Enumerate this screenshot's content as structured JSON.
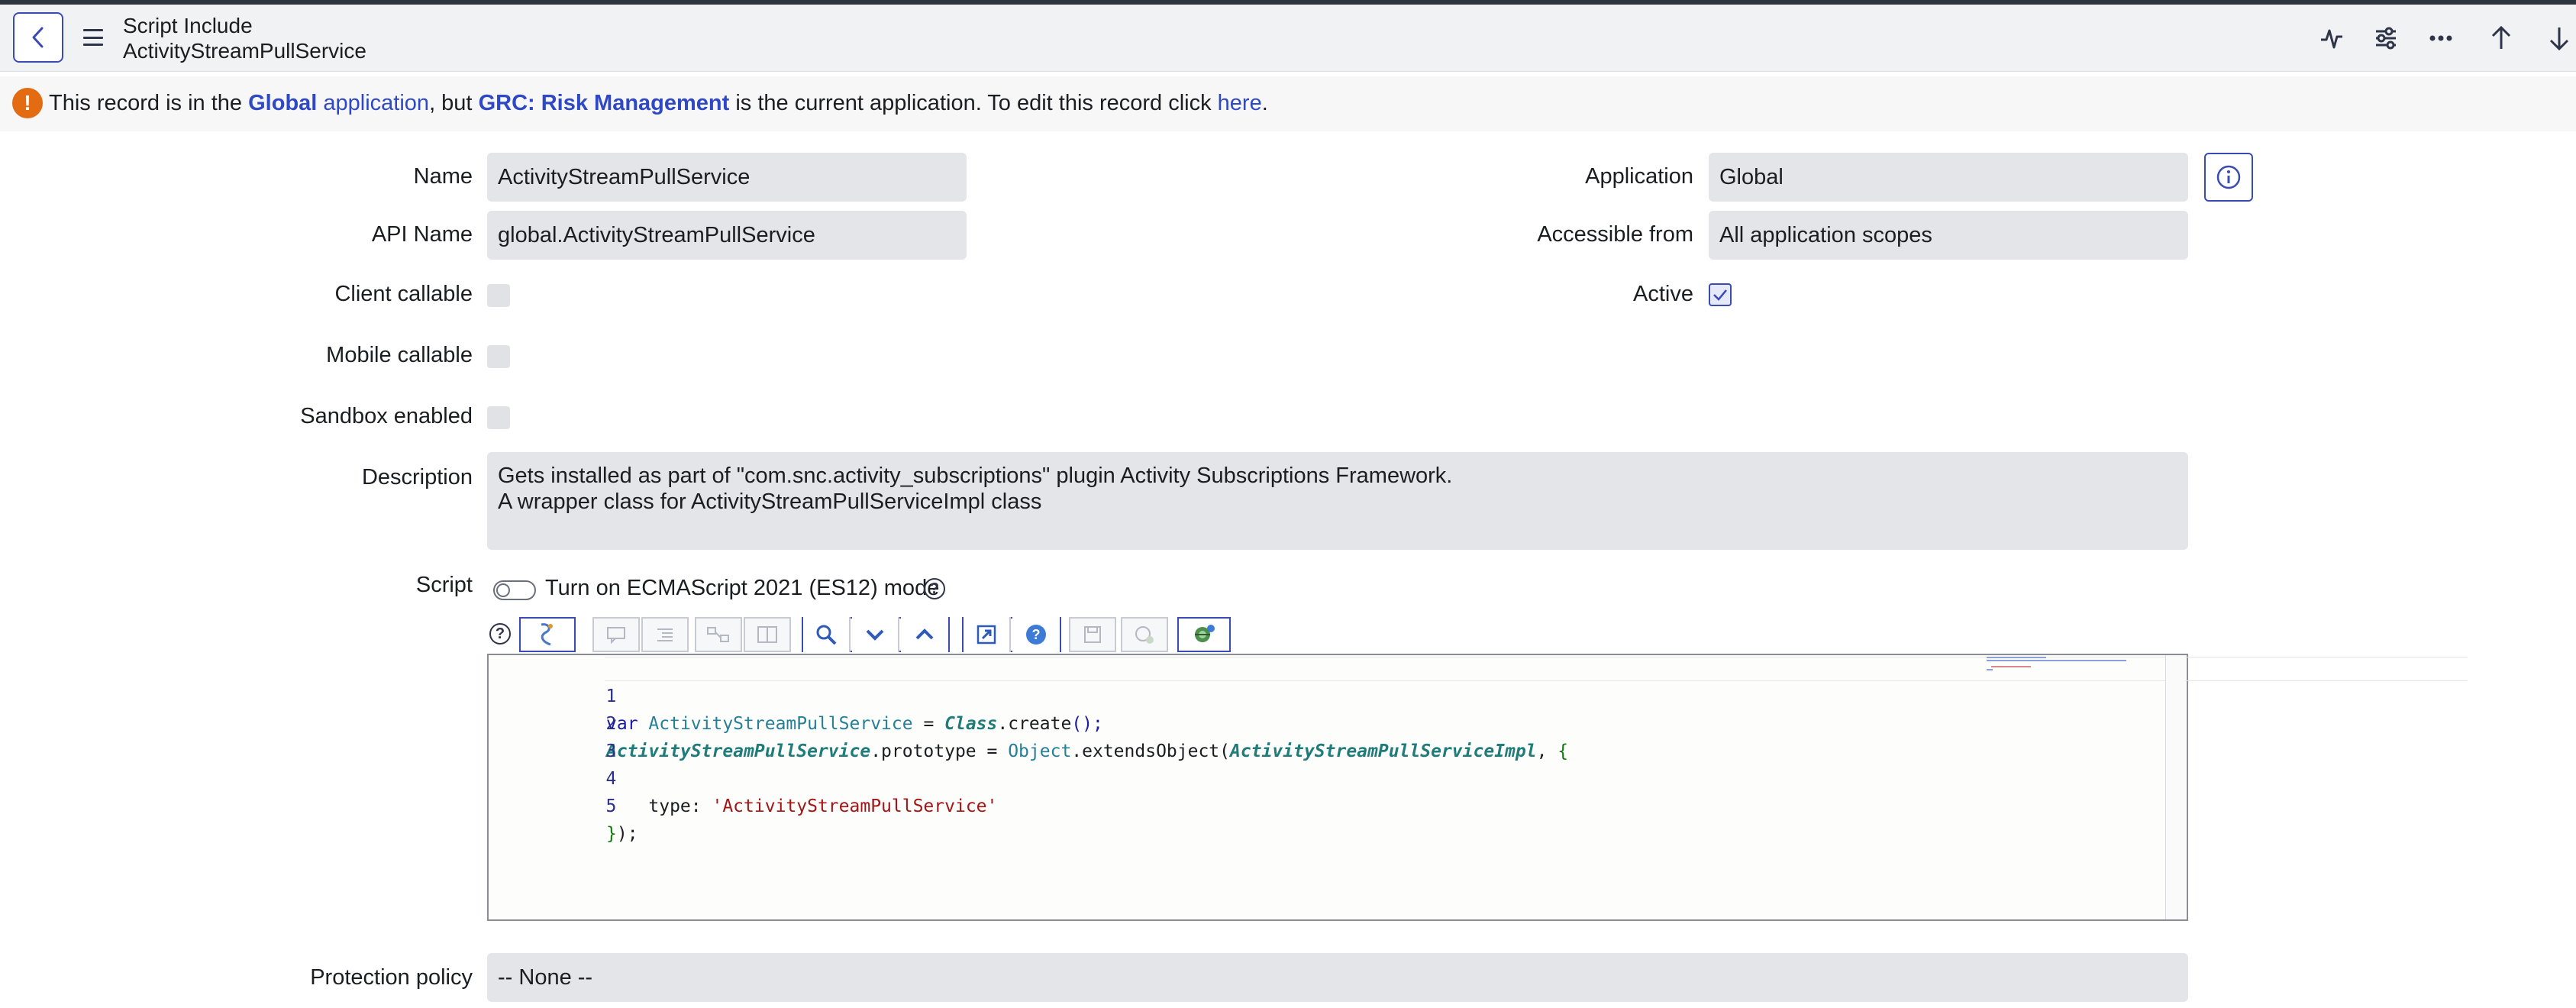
{
  "header": {
    "record_type": "Script Include",
    "record_name": "ActivityStreamPullService"
  },
  "banner": {
    "text_1": "This record is in the ",
    "link_app": "Global",
    "link_app_suffix": " application",
    "text_2": ", but ",
    "link_current": "GRC: Risk Management",
    "text_3": " is the current application. To edit this record click ",
    "link_here": "here",
    "text_4": "."
  },
  "form": {
    "name_label": "Name",
    "name_value": "ActivityStreamPullService",
    "api_name_label": "API Name",
    "api_name_value": "global.ActivityStreamPullService",
    "client_callable_label": "Client callable",
    "client_callable_checked": false,
    "mobile_callable_label": "Mobile callable",
    "mobile_callable_checked": false,
    "sandbox_enabled_label": "Sandbox enabled",
    "sandbox_enabled_checked": false,
    "application_label": "Application",
    "application_value": "Global",
    "accessible_from_label": "Accessible from",
    "accessible_from_value": "All application scopes",
    "active_label": "Active",
    "active_checked": true,
    "description_label": "Description",
    "description_line_1": "Gets installed as part of \"com.snc.activity_subscriptions\" plugin Activity Subscriptions Framework.",
    "description_line_2": "A wrapper class for ActivityStreamPullServiceImpl class",
    "script_label": "Script",
    "ecmascript_toggle_label": "Turn on ECMAScript 2021 (ES12) mode",
    "ecmascript_toggle_on": false,
    "protection_policy_label": "Protection policy",
    "protection_policy_value": "-- None --"
  },
  "script": {
    "line_numbers": [
      "1",
      "2",
      "3",
      "4",
      "5"
    ],
    "line_1": {
      "kw": "var",
      "name": "ActivityStreamPullService",
      "eq": " = ",
      "cls": "Class",
      "rest": ".create",
      "paren": "();"
    },
    "line_2": {
      "name": "ActivityStreamPullService",
      "mid": ".prototype = ",
      "obj": "Object",
      "fn": ".extendsObject(",
      "arg": "ActivityStreamPullServiceImpl",
      "tail": ", ",
      "brace": "{"
    },
    "line_3": "",
    "line_4": {
      "key": "    type: ",
      "val": "'ActivityStreamPullService'"
    },
    "line_5": {
      "brace": "}",
      "rest": ");"
    }
  },
  "toolbar_icons": [
    "format-icon",
    "comment-icon",
    "indent-icon",
    "replace-icon",
    "replace-all-icon",
    "search-icon",
    "find-next-icon",
    "find-previous-icon",
    "fullscreen-icon",
    "help-icon",
    "save-icon",
    "script-debugger-icon",
    "syntax-check-icon"
  ],
  "colors": {
    "accent": "#3b4bb4",
    "link": "#2f49c4",
    "warning": "#e36b12",
    "field_bg": "#e4e5e8"
  }
}
